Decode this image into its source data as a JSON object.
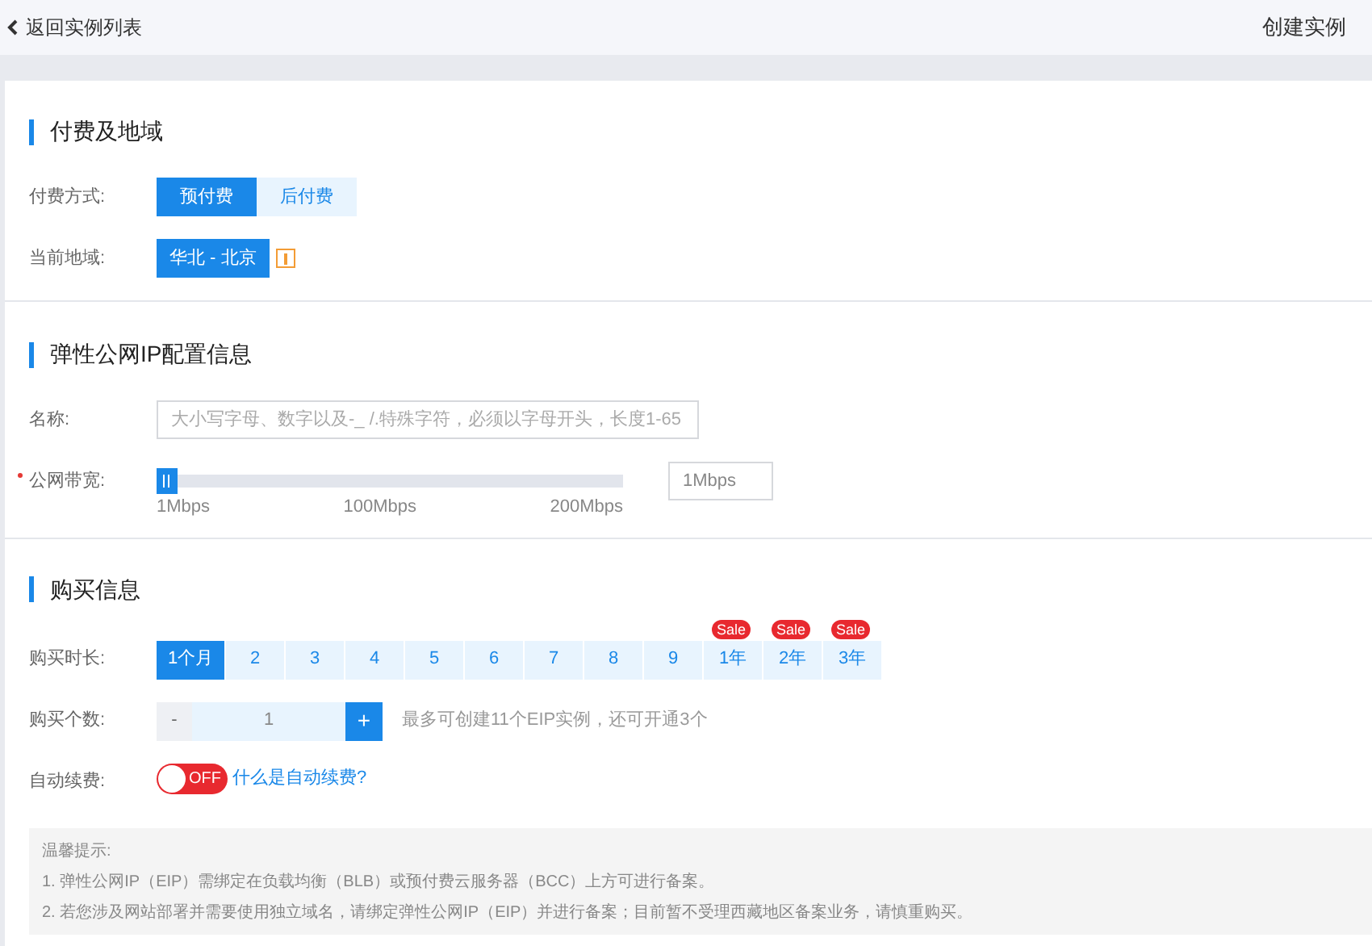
{
  "top_bar": {
    "back_link": "返回实例列表",
    "title": "创建实例"
  },
  "sections": [
    {
      "title": "付费及地域",
      "rows": [
        {
          "kind": "segmented",
          "label": "付费方式:",
          "options": [
            {
              "label": "预付费",
              "selected": true
            },
            {
              "label": "后付费",
              "selected": false
            }
          ]
        },
        {
          "kind": "region",
          "label": "当前地域:",
          "value": "华北 - 北京"
        }
      ]
    },
    {
      "title": "弹性公网IP配置信息",
      "rows": [
        {
          "kind": "text",
          "label": "名称:",
          "placeholder": "大小写字母、数字以及-_ /.特殊字符，必须以字母开头，长度1-65"
        },
        {
          "kind": "slider",
          "label": "公网带宽:",
          "required": true,
          "level": 0,
          "ticks": [
            "1Mbps",
            "100Mbps",
            "200Mbps"
          ],
          "value": "1Mbps"
        }
      ]
    },
    {
      "title": "购买信息",
      "rows": [
        {
          "kind": "duration",
          "label": "购买时长:",
          "options": [
            {
              "label": "1个月",
              "selected": true
            },
            {
              "label": "2",
              "selected": false
            },
            {
              "label": "3",
              "selected": false
            },
            {
              "label": "4",
              "selected": false
            },
            {
              "label": "5",
              "selected": false
            },
            {
              "label": "6",
              "selected": false
            },
            {
              "label": "7",
              "selected": false
            },
            {
              "label": "8",
              "selected": false
            },
            {
              "label": "9",
              "selected": false
            },
            {
              "label": "1年",
              "selected": false,
              "badge": "Sale"
            },
            {
              "label": "2年",
              "selected": false,
              "badge": "Sale"
            },
            {
              "label": "3年",
              "selected": false,
              "badge": "Sale"
            }
          ]
        },
        {
          "kind": "stepper",
          "label": "购买个数:",
          "minus": "-",
          "value": "1",
          "plus": "+",
          "hint": "最多可创建11个EIP实例，还可开通3个"
        },
        {
          "kind": "toggle",
          "label": "自动续费:",
          "on": false,
          "toggle_text": "OFF",
          "link": "什么是自动续费?"
        }
      ]
    }
  ],
  "notice": {
    "title": "温馨提示:",
    "lines": [
      "1. 弹性公网IP（EIP）需绑定在负载均衡（BLB）或预付费云服务器（BCC）上方可进行备案。",
      "2. 若您涉及网站部署并需要使用独立域名，请绑定弹性公网IP（EIP）并进行备案；目前暂不受理西藏地区备案业务，请慎重购买。"
    ]
  }
}
